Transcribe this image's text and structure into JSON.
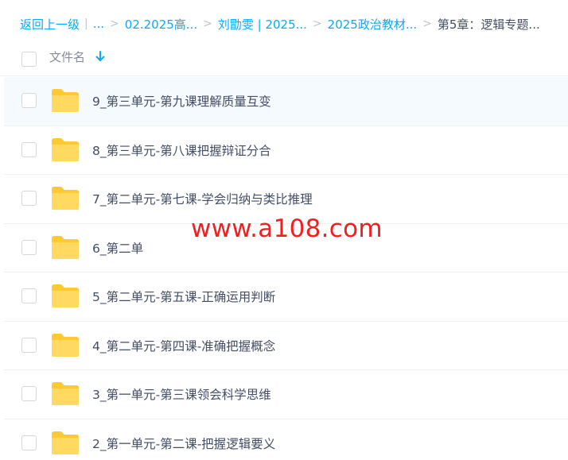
{
  "breadcrumb": {
    "back": "返回上一级",
    "ellipsis": "...",
    "items": [
      "02.2025高...",
      "刘勖雯 | 2025...",
      "2025政治教材..."
    ],
    "current": "第5章：逻辑专题..."
  },
  "header": {
    "column_label": "文件名"
  },
  "files": [
    {
      "name": "9_第三单元-第九课理解质量互变"
    },
    {
      "name": "8_第三单元-第八课把握辩证分合"
    },
    {
      "name": "7_第二单元-第七课-学会归纳与类比推理"
    },
    {
      "name": "6_第二单"
    },
    {
      "name": "5_第二单元-第五课-正确运用判断"
    },
    {
      "name": "4_第二单元-第四课-准确把握概念"
    },
    {
      "name": "3_第一单元-第三课领会科学思维"
    },
    {
      "name": "2_第一单元-第二课-把握逻辑要义"
    }
  ],
  "watermark": "www.a108.com",
  "colors": {
    "accent": "#09aaff",
    "folder": "#ffd14a",
    "watermark": "#f21f1f"
  }
}
